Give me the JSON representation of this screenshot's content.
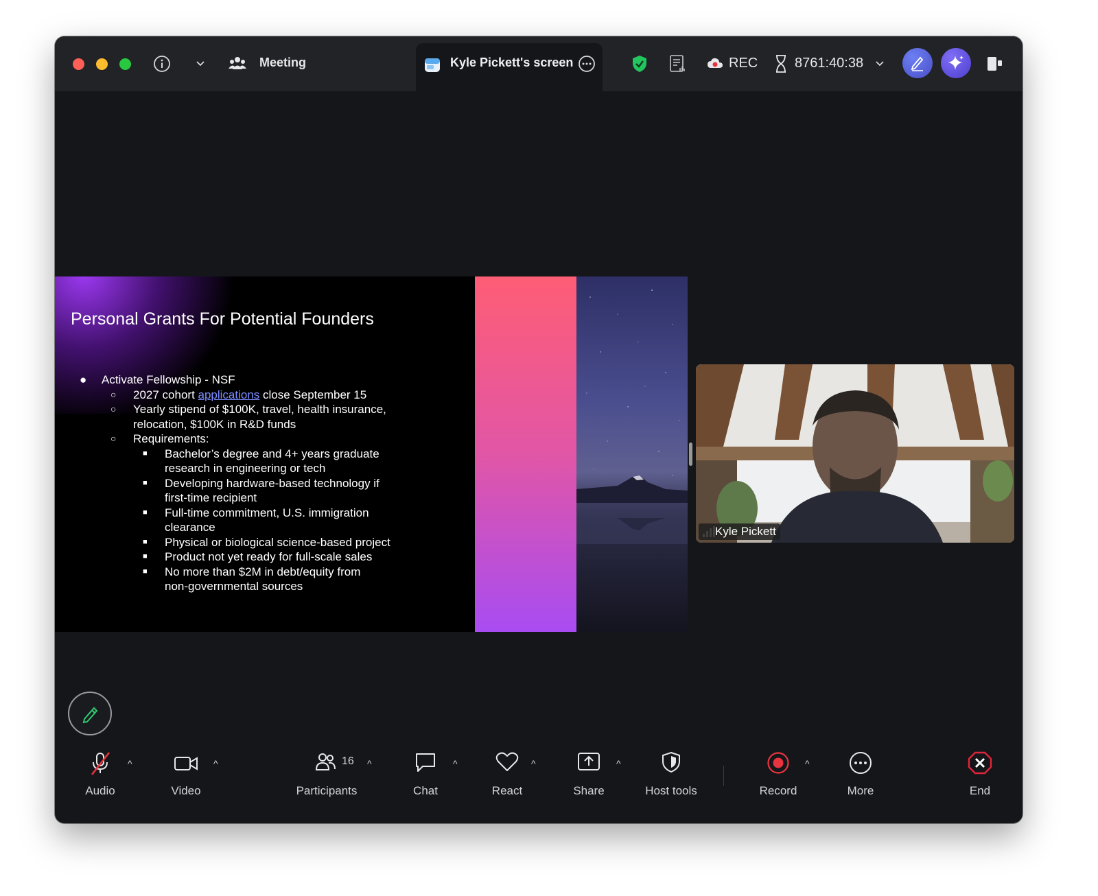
{
  "titlebar": {
    "meeting_label": "Meeting",
    "screen_tab_label": "Kyle Pickett's screen",
    "rec_label": "REC",
    "timer": "8761:40:38"
  },
  "slide": {
    "title": "Personal Grants For Potential Founders",
    "lines": [
      {
        "level": 1,
        "text": "Activate Fellowship - NSF"
      },
      {
        "level": 2,
        "pre": "2027 cohort ",
        "link": "applications",
        "post": " close September 15"
      },
      {
        "level": 2,
        "text": "Yearly stipend of $100K, travel, health insurance,"
      },
      {
        "level": 0,
        "text": "relocation, $100K in R&D funds"
      },
      {
        "level": 2,
        "text": "Requirements:"
      },
      {
        "level": 3,
        "text": "Bachelor’s degree and 4+ years graduate"
      },
      {
        "level": 0,
        "text": "research in engineering or tech"
      },
      {
        "level": 3,
        "text": "Developing hardware-based technology if"
      },
      {
        "level": 0,
        "text": "first-time recipient"
      },
      {
        "level": 3,
        "text": "Full-time commitment, U.S. immigration"
      },
      {
        "level": 0,
        "text": "clearance"
      },
      {
        "level": 3,
        "text": "Physical or biological science-based project"
      },
      {
        "level": 3,
        "text": "Product not yet ready for full-scale sales"
      },
      {
        "level": 3,
        "text": "No more than $2M in debt/equity from"
      },
      {
        "level": 0,
        "text": "non-governmental sources"
      }
    ]
  },
  "video_tile": {
    "participant_name": "Kyle Pickett"
  },
  "toolbar": {
    "audio": "Audio",
    "video": "Video",
    "participants": "Participants",
    "participant_count": "16",
    "chat": "Chat",
    "react": "React",
    "share": "Share",
    "host_tools": "Host tools",
    "record": "Record",
    "more": "More",
    "end": "End"
  },
  "colors": {
    "window_bg": "#15161a",
    "titlebar_bg": "#222327",
    "shield_green": "#22c55e",
    "record_red": "#e8343f",
    "end_red": "#e0243a",
    "annotate_green": "#2ecc71",
    "link_blue": "#7b8cff"
  }
}
